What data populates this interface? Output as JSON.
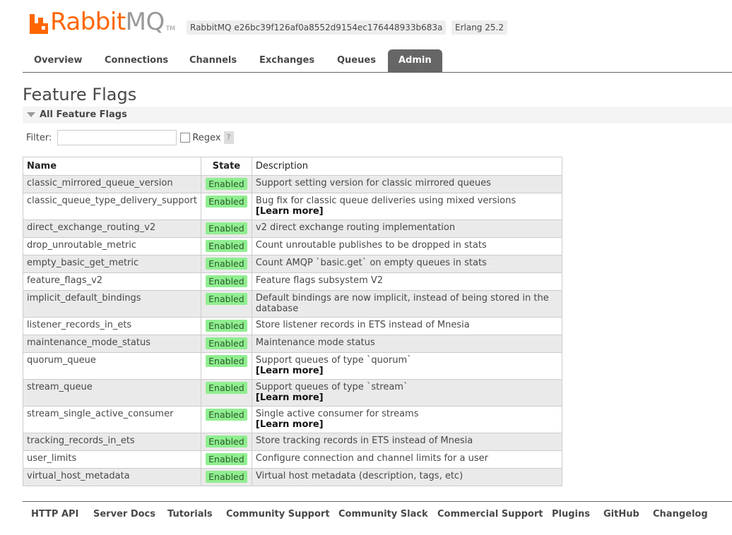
{
  "header": {
    "logo_rabbit": "Rabbit",
    "logo_mq": "MQ",
    "logo_tm": "TM",
    "version_tag": "RabbitMQ e26bc39f126af0a8552d9154ec176448933b683a",
    "erlang_tag": "Erlang 25.2"
  },
  "nav": {
    "tabs": [
      "Overview",
      "Connections",
      "Channels",
      "Exchanges",
      "Queues",
      "Admin"
    ],
    "active": "Admin"
  },
  "page": {
    "title": "Feature Flags",
    "section": "All Feature Flags",
    "filter_label": "Filter:",
    "filter_value": "",
    "regex_label": "Regex",
    "help_label": "?"
  },
  "table": {
    "headers": [
      "Name",
      "State",
      "Description"
    ],
    "rows": [
      {
        "name": "classic_mirrored_queue_version",
        "state": "Enabled",
        "desc": "Support setting version for classic mirrored queues",
        "more": ""
      },
      {
        "name": "classic_queue_type_delivery_support",
        "state": "Enabled",
        "desc": "Bug fix for classic queue deliveries using mixed versions",
        "more": "[Learn more]"
      },
      {
        "name": "direct_exchange_routing_v2",
        "state": "Enabled",
        "desc": "v2 direct exchange routing implementation",
        "more": ""
      },
      {
        "name": "drop_unroutable_metric",
        "state": "Enabled",
        "desc": "Count unroutable publishes to be dropped in stats",
        "more": ""
      },
      {
        "name": "empty_basic_get_metric",
        "state": "Enabled",
        "desc": "Count AMQP `basic.get` on empty queues in stats",
        "more": ""
      },
      {
        "name": "feature_flags_v2",
        "state": "Enabled",
        "desc": "Feature flags subsystem V2",
        "more": ""
      },
      {
        "name": "implicit_default_bindings",
        "state": "Enabled",
        "desc": "Default bindings are now implicit, instead of being stored in the database",
        "more": ""
      },
      {
        "name": "listener_records_in_ets",
        "state": "Enabled",
        "desc": "Store listener records in ETS instead of Mnesia",
        "more": ""
      },
      {
        "name": "maintenance_mode_status",
        "state": "Enabled",
        "desc": "Maintenance mode status",
        "more": ""
      },
      {
        "name": "quorum_queue",
        "state": "Enabled",
        "desc": "Support queues of type `quorum`",
        "more": "[Learn more]"
      },
      {
        "name": "stream_queue",
        "state": "Enabled",
        "desc": "Support queues of type `stream`",
        "more": "[Learn more]"
      },
      {
        "name": "stream_single_active_consumer",
        "state": "Enabled",
        "desc": "Single active consumer for streams",
        "more": "[Learn more]"
      },
      {
        "name": "tracking_records_in_ets",
        "state": "Enabled",
        "desc": "Store tracking records in ETS instead of Mnesia",
        "more": ""
      },
      {
        "name": "user_limits",
        "state": "Enabled",
        "desc": "Configure connection and channel limits for a user",
        "more": ""
      },
      {
        "name": "virtual_host_metadata",
        "state": "Enabled",
        "desc": "Virtual host metadata (description, tags, etc)",
        "more": ""
      }
    ]
  },
  "footer": {
    "links": [
      "HTTP API",
      "Server Docs",
      "Tutorials",
      "Community Support",
      "Community Slack",
      "Commercial Support",
      "Plugins",
      "GitHub",
      "Changelog"
    ]
  },
  "colors": {
    "brand": "#ff6600",
    "enabled_badge": "#90ee90",
    "nav_active": "#666666"
  }
}
